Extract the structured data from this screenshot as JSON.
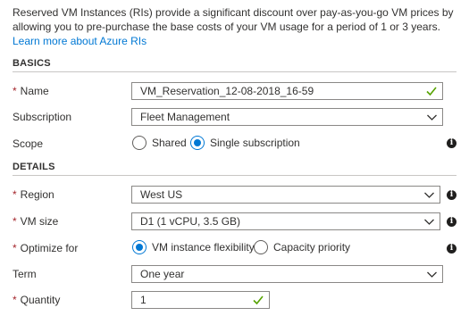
{
  "intro": {
    "text": "Reserved VM Instances (RIs) provide a significant discount over pay-as-you-go VM prices by allowing you to pre-purchase the base costs of your VM usage for a period of 1 or 3 years. ",
    "link": "Learn more about Azure RIs"
  },
  "sections": {
    "basics": "BASICS",
    "details": "DETAILS"
  },
  "required_marker": "*",
  "info_glyph": "i",
  "name": {
    "label": "Name",
    "value": "VM_Reservation_12-08-2018_16-59"
  },
  "subscription": {
    "label": "Subscription",
    "value": "Fleet Management"
  },
  "scope": {
    "label": "Scope",
    "options": [
      "Shared",
      "Single subscription"
    ],
    "selected": "Single subscription"
  },
  "region": {
    "label": "Region",
    "value": "West US"
  },
  "vm_size": {
    "label": "VM size",
    "value": "D1 (1 vCPU, 3.5 GB)"
  },
  "optimize": {
    "label": "Optimize for",
    "options": [
      "VM instance flexibility",
      "Capacity priority"
    ],
    "selected": "VM instance flexibility"
  },
  "term": {
    "label": "Term",
    "value": "One year"
  },
  "quantity": {
    "label": "Quantity",
    "value": "1"
  },
  "colors": {
    "accent": "#0078d4",
    "required": "#a4262c",
    "valid": "#57a300"
  }
}
